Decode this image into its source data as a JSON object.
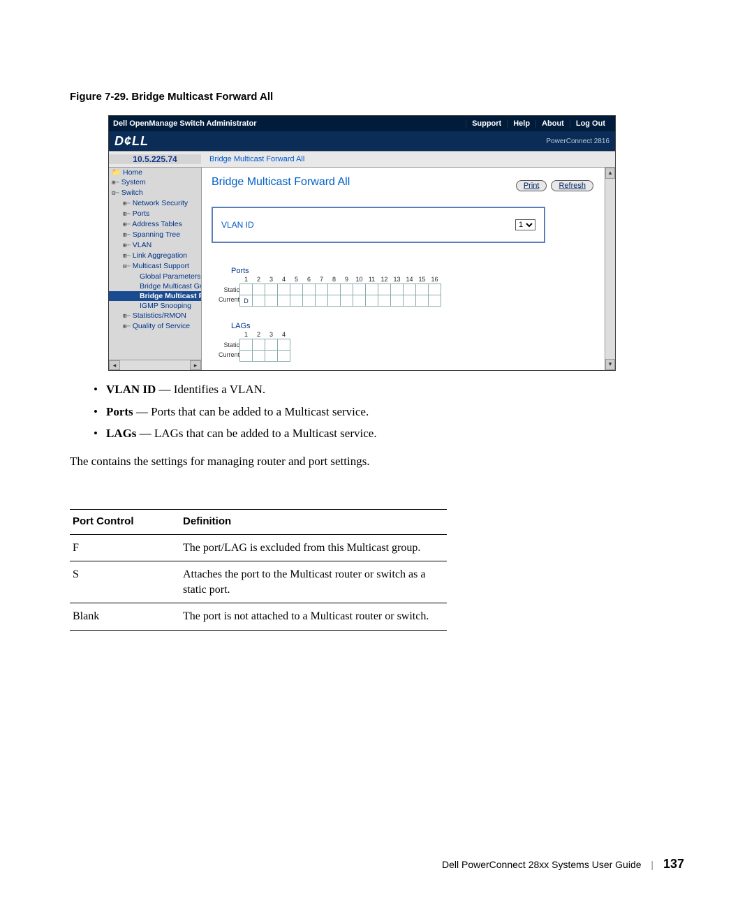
{
  "figure_caption": "Figure 7-29.    Bridge Multicast Forward All",
  "screenshot": {
    "top_title": "Dell OpenManage Switch Administrator",
    "top_links": [
      "Support",
      "Help",
      "About",
      "Log Out"
    ],
    "brand": "D¢LL",
    "model": "PowerConnect 2816",
    "ip": "10.5.225.74",
    "breadcrumb": "Bridge Multicast Forward All",
    "nav": {
      "home": "Home",
      "system": "System",
      "switch": "Switch",
      "netsec": "Network Security",
      "ports": "Ports",
      "addr": "Address Tables",
      "stp": "Spanning Tree",
      "vlan": "VLAN",
      "lagg": "Link Aggregation",
      "mcast": "Multicast Support",
      "global": "Global Parameters",
      "bmg": "Bridge Multicast Gro",
      "bmf": "Bridge Multicast Fo",
      "igmp": "IGMP Snooping",
      "rmon": "Statistics/RMON",
      "qos": "Quality of Service"
    },
    "content": {
      "heading": "Bridge Multicast Forward All",
      "print": "Print",
      "refresh": "Refresh",
      "vlan_label": "VLAN ID",
      "vlan_value": "1",
      "ports_label": "Ports",
      "port_numbers": [
        "1",
        "2",
        "3",
        "4",
        "5",
        "6",
        "7",
        "8",
        "9",
        "10",
        "11",
        "12",
        "13",
        "14",
        "15",
        "16"
      ],
      "row_static": "Static",
      "row_current": "Current",
      "current_port1": "D",
      "lags_label": "LAGs",
      "lag_numbers": [
        "1",
        "2",
        "3",
        "4"
      ]
    }
  },
  "bullets": [
    {
      "term": "VLAN ID",
      "desc": " — Identifies a VLAN."
    },
    {
      "term": "Ports",
      "desc": " — Ports that can be added to a Multicast service."
    },
    {
      "term": "LAGs",
      "desc": " — LAGs that can be added to a Multicast service."
    }
  ],
  "paragraph": "The  contains the settings for managing router and port settings.",
  "table": {
    "headers": [
      "Port Control",
      "Definition"
    ],
    "rows": [
      {
        "c1": "F",
        "c2": " The port/LAG is excluded from this Multicast group."
      },
      {
        "c1": "S",
        "c2": "Attaches the port to the Multicast router or switch as a static port."
      },
      {
        "c1": "Blank",
        "c2": "The port is not attached to a Multicast router or switch."
      }
    ]
  },
  "footer": {
    "text": "Dell PowerConnect 28xx Systems User Guide",
    "page": "137"
  }
}
